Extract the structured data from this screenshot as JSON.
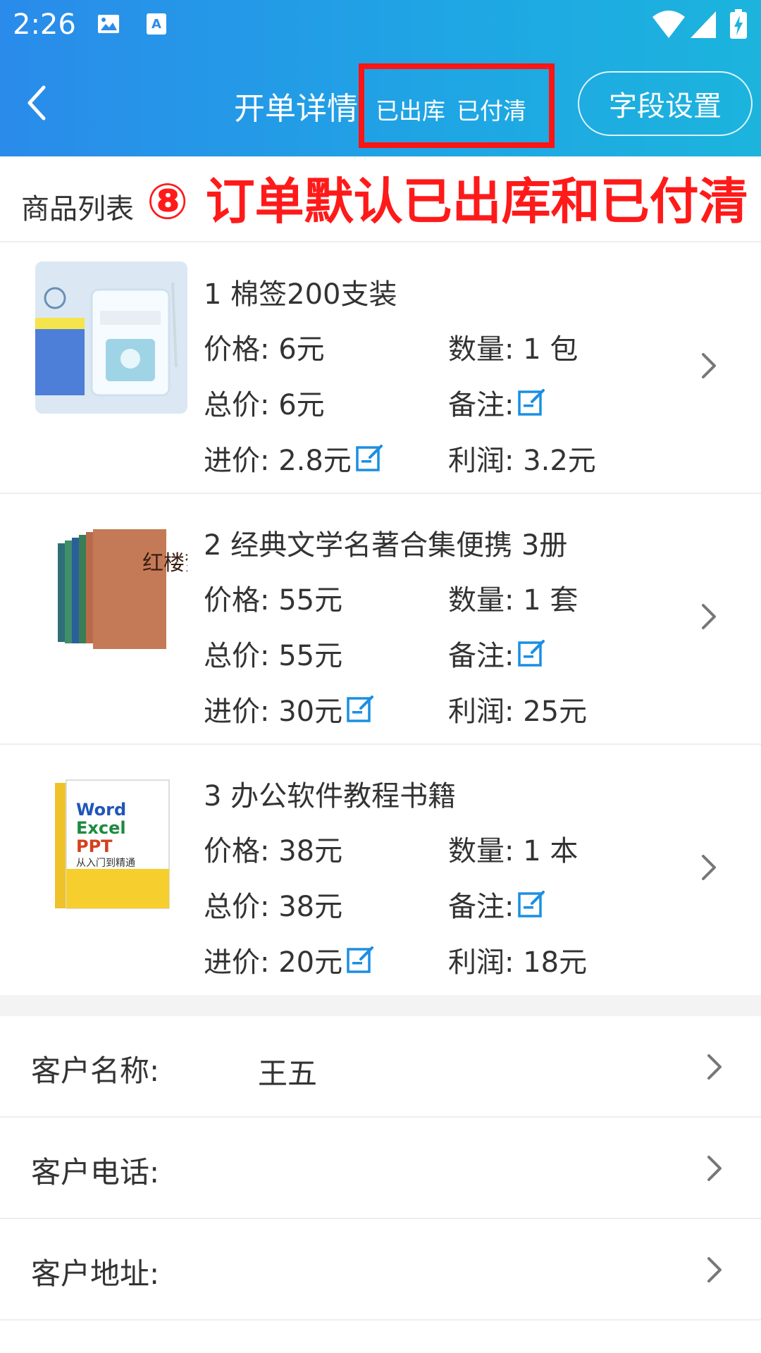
{
  "status_bar": {
    "time": "2:26"
  },
  "header": {
    "title": "开单详情",
    "status_tags": [
      "已出库",
      "已付清"
    ],
    "field_settings_label": "字段设置"
  },
  "section": {
    "label": "商品列表",
    "annotation": "⑧ 订单默认已出库和已付清"
  },
  "products": [
    {
      "name": "1 棉签200支装",
      "price": "价格: 6元",
      "quantity": "数量: 1 包",
      "total": "总价: 6元",
      "remark": "备注:",
      "cost": "进价: 2.8元",
      "profit": "利润: 3.2元",
      "image": "cotton-swab-box"
    },
    {
      "name": "2 经典文学名著合集便携 3册",
      "price": "价格: 55元",
      "quantity": "数量: 1 套",
      "total": "总价: 55元",
      "remark": "备注:",
      "cost": "进价: 30元",
      "profit": "利润: 25元",
      "image": "book-set-hongloumeng",
      "image_title": "红楼梦"
    },
    {
      "name": "3 办公软件教程书籍",
      "price": "价格: 38元",
      "quantity": "数量: 1 本",
      "total": "总价: 38元",
      "remark": "备注:",
      "cost": "进价: 20元",
      "profit": "利润: 18元",
      "image": "office-book",
      "image_lines": [
        "Word",
        "Excel",
        "PPT",
        "从入门到精通"
      ]
    }
  ],
  "customer": [
    {
      "label": "客户名称:",
      "value": "王五"
    },
    {
      "label": "客户电话:",
      "value": ""
    },
    {
      "label": "客户地址:",
      "value": ""
    }
  ],
  "colors": {
    "header_start": "#2a8bea",
    "header_end": "#1cb4dd",
    "annotation_red": "#ff1a1a",
    "edit_icon_blue": "#1a8fe3"
  },
  "icons": [
    "back-arrow-icon",
    "edit-icon",
    "chevron-right-icon",
    "wifi-icon",
    "signal-icon",
    "battery-icon",
    "image-icon",
    "keyboard-a-icon"
  ]
}
